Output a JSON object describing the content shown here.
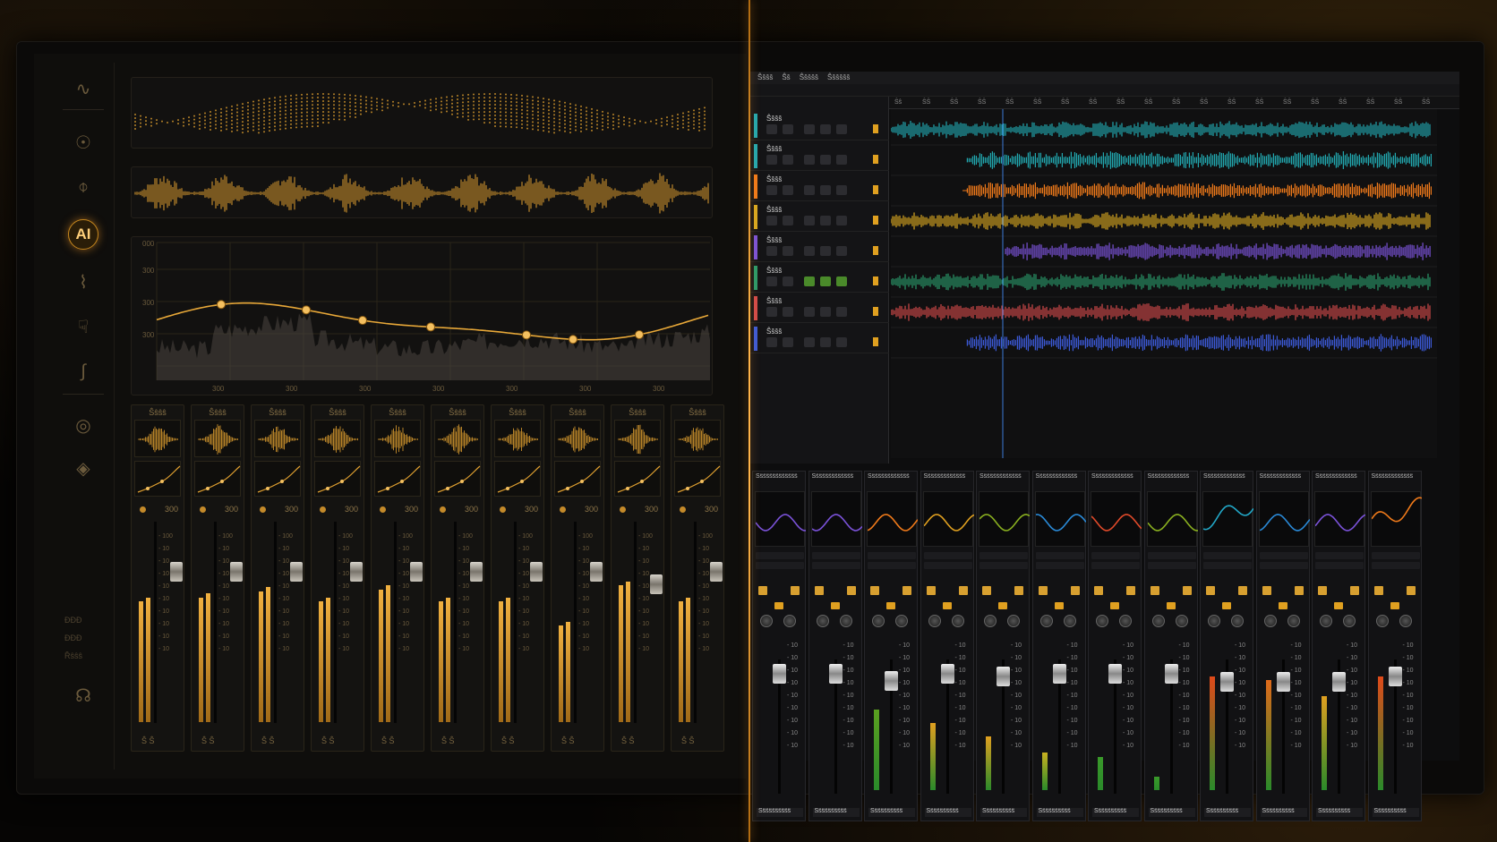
{
  "colors": {
    "gold": "#e0a030",
    "teal": "#22a8b0",
    "orange": "#f07a1a",
    "yellow": "#d8a820",
    "purple": "#7a52d8",
    "green": "#2a9a6a",
    "red": "#d24a4a",
    "blue": "#3c5ad8"
  },
  "left": {
    "sidebar": {
      "icons": [
        "wave-icon",
        "podcast-icon",
        "phase-icon",
        "ai-icon",
        "pulse-icon",
        "hand-icon",
        "squiggle-icon",
        "eye-icon",
        "cube-icon",
        "headset-icon"
      ],
      "ai_label": "AI",
      "footer": [
        "ĐĐĐ",
        "ĐĐĐ",
        "Řŝŝŝ"
      ]
    },
    "graph": {
      "y_ticks": [
        "000",
        "300",
        "300",
        "300"
      ],
      "x_ticks": [
        "300",
        "300",
        "300",
        "300",
        "300",
        "300",
        "300"
      ]
    },
    "strips": [
      {
        "name": "Ŝŝŝŝ",
        "value": "300",
        "scale": [
          "- 100",
          "- 10",
          "- 10",
          "- 10",
          "- 10",
          "- 10",
          "- 10",
          "- 10",
          "- 10",
          "- 10"
        ],
        "fader": 0.2,
        "meter": 0.6,
        "foot": "Ŝ Ŝ"
      },
      {
        "name": "Ŝŝŝŝ",
        "value": "300",
        "scale": [
          "- 100",
          "- 10",
          "- 10",
          "- 10",
          "- 10",
          "- 10",
          "- 10",
          "- 10",
          "- 10",
          "- 10"
        ],
        "fader": 0.2,
        "meter": 0.62,
        "foot": "Ŝ Ŝ"
      },
      {
        "name": "Ŝŝŝŝ",
        "value": "300",
        "scale": [
          "- 100",
          "- 10",
          "- 10",
          "- 10",
          "- 10",
          "- 10",
          "- 10",
          "- 10",
          "- 10",
          "- 10"
        ],
        "fader": 0.2,
        "meter": 0.65,
        "foot": "Ŝ Ŝ"
      },
      {
        "name": "Ŝŝŝŝ",
        "value": "300",
        "scale": [
          "- 100",
          "- 10",
          "- 10",
          "- 10",
          "- 10",
          "- 10",
          "- 10",
          "- 10",
          "- 10",
          "- 10"
        ],
        "fader": 0.2,
        "meter": 0.6,
        "foot": "Ŝ Ŝ"
      },
      {
        "name": "Ŝŝŝŝ",
        "value": "300",
        "scale": [
          "- 100",
          "- 10",
          "- 10",
          "- 10",
          "- 10",
          "- 10",
          "- 10",
          "- 10",
          "- 10",
          "- 10"
        ],
        "fader": 0.2,
        "meter": 0.66,
        "foot": "Ŝ Ŝ"
      },
      {
        "name": "Ŝŝŝŝ",
        "value": "300",
        "scale": [
          "- 100",
          "- 10",
          "- 10",
          "- 10",
          "- 10",
          "- 10",
          "- 10",
          "- 10",
          "- 10",
          "- 10"
        ],
        "fader": 0.2,
        "meter": 0.6,
        "foot": "Ŝ Ŝ"
      },
      {
        "name": "Ŝŝŝŝ",
        "value": "300",
        "scale": [
          "- 100",
          "- 10",
          "- 10",
          "- 10",
          "- 10",
          "- 10",
          "- 10",
          "- 10",
          "- 10",
          "- 10"
        ],
        "fader": 0.2,
        "meter": 0.6,
        "foot": "Ŝ Ŝ"
      },
      {
        "name": "Ŝŝŝŝ",
        "value": "300",
        "scale": [
          "- 100",
          "- 10",
          "- 10",
          "- 10",
          "- 10",
          "- 10",
          "- 10",
          "- 10",
          "- 10",
          "- 10"
        ],
        "fader": 0.2,
        "meter": 0.48,
        "foot": "Ŝ Ŝ"
      },
      {
        "name": "Ŝŝŝŝ",
        "value": "300",
        "scale": [
          "- 100",
          "- 10",
          "- 10",
          "- 10",
          "- 10",
          "- 10",
          "- 10",
          "- 10",
          "- 10",
          "- 10"
        ],
        "fader": 0.26,
        "meter": 0.68,
        "foot": "Ŝ Ŝ"
      },
      {
        "name": "Ŝŝŝŝ",
        "value": "300",
        "scale": [
          "- 100",
          "- 10",
          "- 10",
          "- 10",
          "- 10",
          "- 10",
          "- 10",
          "- 10",
          "- 10",
          "- 10"
        ],
        "fader": 0.2,
        "meter": 0.6,
        "foot": "Ŝ Ŝ"
      }
    ]
  },
  "right": {
    "menu": [
      "Ŝŝŝŝ",
      "Ŝŝ",
      "Ŝŝŝŝŝ",
      "Ŝŝŝŝŝŝ"
    ],
    "ruler": [
      "Ŝŝ",
      "ŜŜ",
      "ŜŜ",
      "ŜŜ",
      "ŜŜ",
      "ŜŜ",
      "ŜŜ",
      "ŜŜ",
      "ŜŜ",
      "ŜŜ",
      "ŜŜ",
      "ŜŜ",
      "ŜŜ",
      "ŜŜ",
      "ŜŜ",
      "ŜŜ",
      "ŜŜ",
      "ŜŜ",
      "ŜŜ",
      "ŜŜ"
    ],
    "tracks": [
      {
        "name": "Ŝŝŝŝ",
        "color": "#22a8b0",
        "start": 0.0
      },
      {
        "name": "Ŝŝŝŝ",
        "color": "#22a8b0",
        "start": 0.14
      },
      {
        "name": "Ŝŝŝŝ",
        "color": "#f07a1a",
        "start": 0.14
      },
      {
        "name": "Ŝŝŝŝ",
        "color": "#d8a820",
        "start": 0.0
      },
      {
        "name": "Ŝŝŝŝ",
        "color": "#7a52d8",
        "start": 0.21
      },
      {
        "name": "Ŝŝŝŝ",
        "color": "#2a9a6a",
        "start": 0.0
      },
      {
        "name": "Ŝŝŝŝ",
        "color": "#d24a4a",
        "start": 0.0
      },
      {
        "name": "Ŝŝŝŝ",
        "color": "#3c5ad8",
        "start": 0.14
      }
    ],
    "strips": [
      {
        "name": "Ŝŝŝŝŝŝŝŝŝŝŝŝŝ",
        "eq_color": "#7a52d8",
        "meter": 0.0,
        "meter_color": "#2a9a3a",
        "fader": 0.1,
        "foot": "Ŝŝŝŝŝŝŝŝŝŝ"
      },
      {
        "name": "Ŝŝŝŝŝŝŝŝŝŝŝŝŝ",
        "eq_color": "#7a52d8",
        "meter": 0.0,
        "meter_color": "#2a9a3a",
        "fader": 0.1,
        "foot": "Ŝŝŝŝŝŝŝŝŝŝ"
      },
      {
        "name": "Ŝŝŝŝŝŝŝŝŝŝŝŝŝ",
        "eq_color": "#f07a1a",
        "meter": 0.6,
        "meter_color": "#5aa020",
        "fader": 0.15,
        "foot": "Ŝŝŝŝŝŝŝŝŝŝ"
      },
      {
        "name": "Ŝŝŝŝŝŝŝŝŝŝŝŝŝ",
        "eq_color": "#e0a020",
        "meter": 0.5,
        "meter_color": "#e0a020",
        "fader": 0.1,
        "foot": "Ŝŝŝŝŝŝŝŝŝŝ"
      },
      {
        "name": "Ŝŝŝŝŝŝŝŝŝŝŝŝŝ",
        "eq_color": "#8ab020",
        "meter": 0.4,
        "meter_color": "#e0a020",
        "fader": 0.12,
        "foot": "Ŝŝŝŝŝŝŝŝŝŝ"
      },
      {
        "name": "Ŝŝŝŝŝŝŝŝŝŝŝŝŝ",
        "eq_color": "#2a8ad8",
        "meter": 0.28,
        "meter_color": "#c8b020",
        "fader": 0.1,
        "foot": "Ŝŝŝŝŝŝŝŝŝŝ"
      },
      {
        "name": "Ŝŝŝŝŝŝŝŝŝŝŝŝŝ",
        "eq_color": "#e04a2a",
        "meter": 0.25,
        "meter_color": "#3a9a2a",
        "fader": 0.1,
        "foot": "Ŝŝŝŝŝŝŝŝŝŝ"
      },
      {
        "name": "Ŝŝŝŝŝŝŝŝŝŝŝŝŝ",
        "eq_color": "#8ab020",
        "meter": 0.1,
        "meter_color": "#3a9a2a",
        "fader": 0.1,
        "foot": "Ŝŝŝŝŝŝŝŝŝŝ"
      },
      {
        "name": "Ŝŝŝŝŝŝŝŝŝŝŝŝŝ",
        "eq_color": "#22a8c8",
        "meter": 0.85,
        "meter_color": "#e04a1a",
        "fader": 0.16,
        "foot": "Ŝŝŝŝŝŝŝŝŝŝ"
      },
      {
        "name": "Ŝŝŝŝŝŝŝŝŝŝŝŝŝ",
        "eq_color": "#2a8ad8",
        "meter": 0.82,
        "meter_color": "#e06a1a",
        "fader": 0.16,
        "foot": "Ŝŝŝŝŝŝŝŝŝŝ"
      },
      {
        "name": "Ŝŝŝŝŝŝŝŝŝŝŝŝŝ",
        "eq_color": "#7a52d8",
        "meter": 0.7,
        "meter_color": "#e0a020",
        "fader": 0.16,
        "foot": "Ŝŝŝŝŝŝŝŝŝŝ"
      },
      {
        "name": "Ŝŝŝŝŝŝŝŝŝŝŝŝŝ",
        "eq_color": "#f07a1a",
        "meter": 0.85,
        "meter_color": "#e04a1a",
        "fader": 0.12,
        "foot": "Ŝŝŝŝŝŝŝŝŝŝ"
      }
    ],
    "scale": [
      "- 10",
      "- 10",
      "- 10",
      "- 10",
      "- 10",
      "- 10",
      "- 10",
      "- 10",
      "- 10"
    ]
  }
}
